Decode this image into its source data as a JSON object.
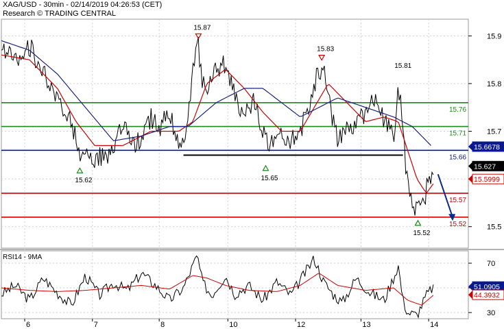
{
  "header": {
    "title": "XAG/USD - 30min - 02/14/2019 04:26:53 (CET)",
    "source": "Research © TRADING CENTRAL"
  },
  "colors": {
    "price": "#000000",
    "ma_fast": "#cc0000",
    "ma_slow": "#1a237e",
    "support_red": "#cc0000",
    "resistance_green": "#1a8a1a",
    "pivot_blue": "#0a1a8c",
    "arrow": "#0a2a8c",
    "rsi": "#000000",
    "rsi_ma": "#cc0000",
    "grid": "#cfcfcf"
  },
  "chart_data": [
    {
      "type": "line",
      "title": "XAG/USD - 30min",
      "x_labels": [
        "6",
        "7",
        "8",
        "10",
        "12",
        "13",
        "14"
      ],
      "ylim": [
        15.455,
        15.935
      ],
      "y_ticks": [
        15.5,
        15.6,
        15.7,
        15.8,
        15.9
      ],
      "y_tick_labels": [
        "15.5",
        "15.6",
        "15.7",
        "15.8",
        "15.9"
      ],
      "horizontal_levels": [
        {
          "value": 15.76,
          "label": "15.76",
          "color": "green"
        },
        {
          "value": 15.71,
          "label": "15.71",
          "color": "green"
        },
        {
          "value": 15.66,
          "label": "15.66",
          "color": "blue"
        },
        {
          "value": 15.57,
          "label": "15.57",
          "color": "red"
        },
        {
          "value": 15.52,
          "label": "15.52",
          "color": "red"
        }
      ],
      "price_tags": [
        {
          "value": 15.6678,
          "label": "15.6678",
          "style": "blue"
        },
        {
          "value": 15.627,
          "label": "15.627",
          "style": "black"
        },
        {
          "value": 15.5999,
          "label": "15.5999",
          "style": "red"
        }
      ],
      "annotations": [
        {
          "label": "15.87",
          "kind": "high",
          "t": 0.422,
          "value": 15.89
        },
        {
          "label": "15.83",
          "kind": "high",
          "t": 0.686,
          "value": 15.845
        },
        {
          "label": "15.81",
          "kind": "high",
          "t": 0.852,
          "value": 15.81
        },
        {
          "label": "15.62",
          "kind": "low",
          "t": 0.168,
          "value": 15.63
        },
        {
          "label": "15.65",
          "kind": "low",
          "t": 0.566,
          "value": 15.635
        },
        {
          "label": "15.52",
          "kind": "low",
          "t": 0.892,
          "value": 15.52
        }
      ],
      "series": [
        {
          "key": "price",
          "t": [
            0,
            0.03,
            0.06,
            0.09,
            0.12,
            0.15,
            0.165,
            0.18,
            0.2,
            0.22,
            0.24,
            0.26,
            0.28,
            0.3,
            0.32,
            0.34,
            0.36,
            0.38,
            0.39,
            0.4,
            0.41,
            0.422,
            0.43,
            0.44,
            0.46,
            0.48,
            0.5,
            0.52,
            0.54,
            0.56,
            0.58,
            0.6,
            0.62,
            0.64,
            0.66,
            0.676,
            0.69,
            0.7,
            0.71,
            0.72,
            0.74,
            0.76,
            0.78,
            0.8,
            0.82,
            0.84,
            0.85,
            0.857,
            0.865,
            0.875,
            0.885,
            0.895,
            0.905,
            0.915,
            0.925
          ],
          "values": [
            15.87,
            15.85,
            15.88,
            15.82,
            15.76,
            15.72,
            15.66,
            15.65,
            15.64,
            15.65,
            15.66,
            15.71,
            15.67,
            15.68,
            15.73,
            15.71,
            15.74,
            15.68,
            15.66,
            15.72,
            15.83,
            15.88,
            15.8,
            15.78,
            15.83,
            15.84,
            15.77,
            15.74,
            15.76,
            15.7,
            15.67,
            15.69,
            15.68,
            15.7,
            15.76,
            15.82,
            15.84,
            15.78,
            15.72,
            15.68,
            15.7,
            15.72,
            15.74,
            15.77,
            15.72,
            15.69,
            15.79,
            15.74,
            15.63,
            15.58,
            15.53,
            15.56,
            15.55,
            15.6,
            15.627
          ]
        },
        {
          "key": "ma_fast",
          "t": [
            0,
            0.06,
            0.12,
            0.16,
            0.2,
            0.26,
            0.32,
            0.38,
            0.41,
            0.44,
            0.48,
            0.52,
            0.56,
            0.6,
            0.64,
            0.67,
            0.7,
            0.74,
            0.78,
            0.82,
            0.85,
            0.87,
            0.89,
            0.91,
            0.925
          ],
          "values": [
            15.86,
            15.85,
            15.79,
            15.72,
            15.67,
            15.67,
            15.7,
            15.7,
            15.72,
            15.8,
            15.83,
            15.79,
            15.74,
            15.7,
            15.7,
            15.75,
            15.8,
            15.76,
            15.72,
            15.73,
            15.72,
            15.66,
            15.6,
            15.57,
            15.59
          ]
        },
        {
          "key": "ma_slow",
          "t": [
            0,
            0.06,
            0.12,
            0.18,
            0.24,
            0.3,
            0.36,
            0.4,
            0.46,
            0.52,
            0.56,
            0.6,
            0.64,
            0.68,
            0.72,
            0.78,
            0.84,
            0.88,
            0.92
          ],
          "values": [
            15.89,
            15.87,
            15.82,
            15.75,
            15.68,
            15.69,
            15.71,
            15.71,
            15.76,
            15.79,
            15.79,
            15.76,
            15.73,
            15.75,
            15.77,
            15.75,
            15.73,
            15.71,
            15.67
          ]
        }
      ],
      "projection_arrow": {
        "t_from": 0.935,
        "value_from": 15.61,
        "t_to": 0.965,
        "value_to": 15.515
      }
    },
    {
      "type": "line",
      "title": "RSI14 - 9MA",
      "ylim": [
        25,
        80
      ],
      "y_ticks": [
        30,
        50,
        70
      ],
      "y_tick_labels": [
        "30",
        "50",
        "70"
      ],
      "price_tags": [
        {
          "value": 51.0905,
          "label": "51.0905",
          "style": "blue"
        },
        {
          "value": 44.3932,
          "label": "44.3932",
          "style": "red"
        }
      ],
      "series": [
        {
          "key": "rsi",
          "t": [
            0,
            0.03,
            0.06,
            0.09,
            0.12,
            0.15,
            0.18,
            0.21,
            0.24,
            0.27,
            0.3,
            0.33,
            0.36,
            0.39,
            0.41,
            0.42,
            0.43,
            0.45,
            0.48,
            0.5,
            0.53,
            0.56,
            0.59,
            0.62,
            0.65,
            0.67,
            0.69,
            0.71,
            0.73,
            0.76,
            0.79,
            0.82,
            0.85,
            0.86,
            0.87,
            0.89,
            0.9,
            0.91,
            0.925
          ],
          "values": [
            45,
            52,
            40,
            58,
            46,
            36,
            60,
            44,
            54,
            48,
            62,
            52,
            40,
            50,
            68,
            76,
            55,
            44,
            60,
            45,
            52,
            40,
            55,
            44,
            62,
            74,
            55,
            45,
            38,
            58,
            46,
            40,
            68,
            40,
            30,
            28,
            36,
            44,
            51
          ]
        },
        {
          "key": "rsi_ma",
          "t": [
            0,
            0.06,
            0.12,
            0.18,
            0.24,
            0.3,
            0.36,
            0.41,
            0.44,
            0.48,
            0.53,
            0.59,
            0.64,
            0.68,
            0.72,
            0.78,
            0.84,
            0.87,
            0.9,
            0.925
          ],
          "values": [
            50,
            48,
            47,
            48,
            50,
            52,
            49,
            60,
            58,
            52,
            48,
            47,
            52,
            62,
            52,
            48,
            50,
            40,
            36,
            44
          ]
        }
      ]
    }
  ],
  "rsi_label": "RSI14 - 9MA"
}
